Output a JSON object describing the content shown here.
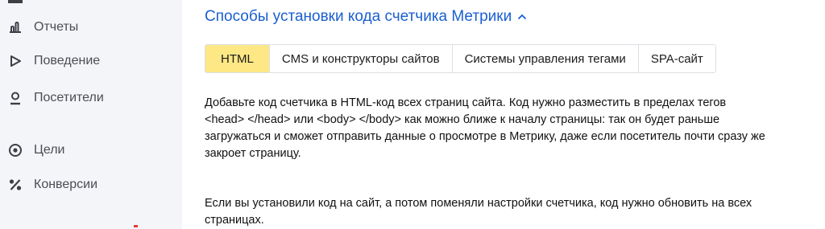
{
  "sidebar": {
    "items": [
      {
        "label": "Отчеты",
        "icon": "bar-chart-icon"
      },
      {
        "label": "Поведение",
        "icon": "play-outline-icon"
      },
      {
        "label": "Посетители",
        "icon": "user-icon"
      },
      {
        "label": "Цели",
        "icon": "target-icon"
      },
      {
        "label": "Конверсии",
        "icon": "percent-icon"
      }
    ]
  },
  "main": {
    "title": "Способы установки кода счетчика Метрики",
    "tabs": [
      {
        "label": "HTML",
        "active": true
      },
      {
        "label": "CMS и конструкторы сайтов",
        "active": false
      },
      {
        "label": "Системы управления тегами",
        "active": false
      },
      {
        "label": "SPA-сайт",
        "active": false
      }
    ],
    "paragraph1": "Добавьте код счетчика в HTML-код всех страниц сайта. Код нужно разместить в пределах тегов <head> </head> или <body> </body> как можно ближе к началу страницы: так он будет раньше загружаться и сможет отправить данные о просмотре в Метрику, даже если посетитель почти сразу же закроет страницу.",
    "paragraph2": "Если вы установили код на сайт, а потом поменяли настройки счетчика, код нужно обновить на всех страницах."
  },
  "colors": {
    "accent_link": "#1a5fd0",
    "active_tab": "#fde885",
    "sidebar_bg": "#f4f5f8"
  }
}
